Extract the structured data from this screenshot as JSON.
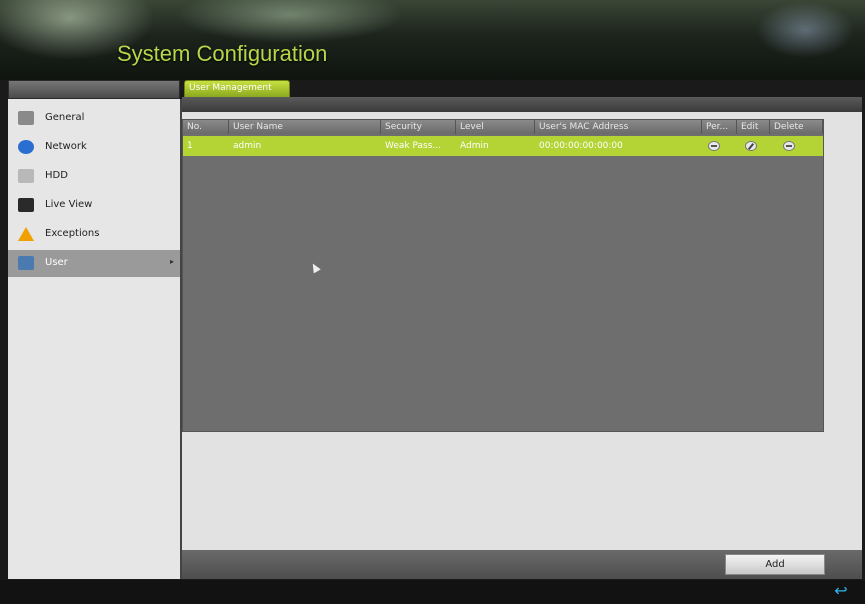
{
  "header": {
    "title": "System Configuration"
  },
  "sidebar": {
    "items": [
      {
        "label": "General",
        "icon": "general-icon",
        "color": "#8a8a8a",
        "active": false
      },
      {
        "label": "Network",
        "icon": "network-globe-icon",
        "color": "#2a6fd0",
        "active": false
      },
      {
        "label": "HDD",
        "icon": "hdd-icon",
        "color": "#b8b8b8",
        "active": false
      },
      {
        "label": "Live View",
        "icon": "live-view-monitor-icon",
        "color": "#2a2a2a",
        "active": false
      },
      {
        "label": "Exceptions",
        "icon": "warning-icon",
        "color": "#f0a000",
        "active": false
      },
      {
        "label": "User",
        "icon": "user-icon",
        "color": "#4a7ab0",
        "active": true
      }
    ],
    "active_arrow": "▸"
  },
  "tabs": [
    {
      "label": "User Management",
      "active": true
    }
  ],
  "table": {
    "columns": [
      "No.",
      "User Name",
      "Security",
      "Level",
      "User's MAC Address",
      "Per...",
      "Edit",
      "Delete"
    ],
    "rows": [
      {
        "no": "1",
        "user_name": "admin",
        "security": "Weak Pass...",
        "level": "Admin",
        "mac": "00:00:00:00:00:00"
      }
    ]
  },
  "buttons": {
    "add": "Add"
  },
  "footer": {
    "back_icon": "↩"
  },
  "colors": {
    "accent": "#b4d334",
    "title": "#b8d64a",
    "back": "#2fb4e8"
  }
}
